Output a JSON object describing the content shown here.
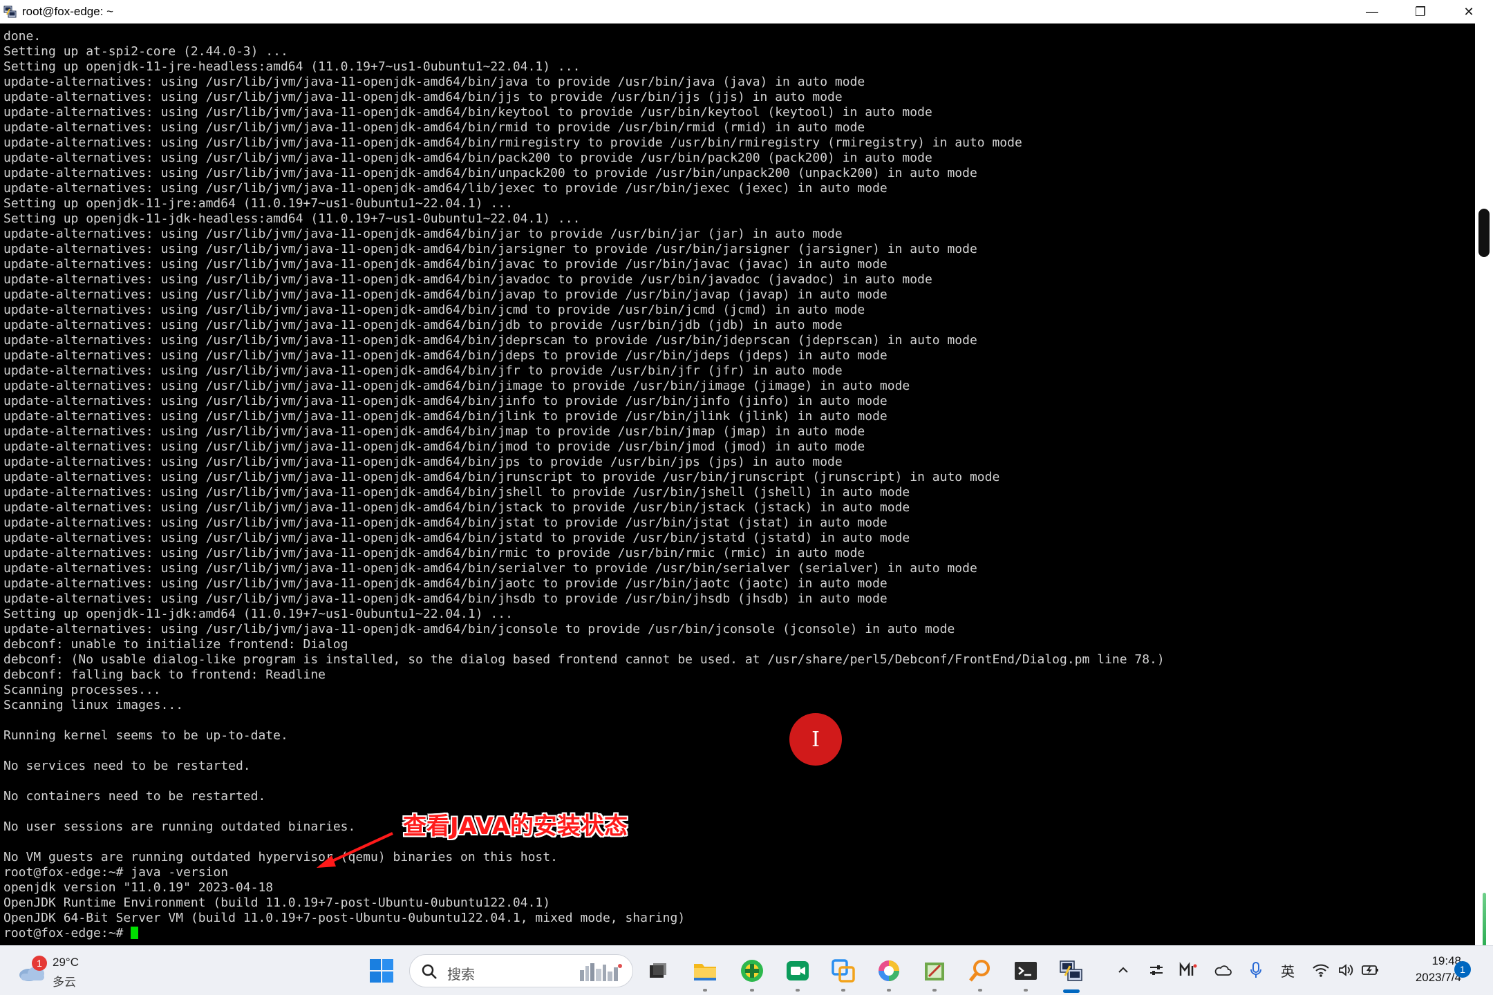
{
  "window": {
    "title": "root@fox-edge: ~",
    "minimize_glyph": "—",
    "restore_glyph": "❐",
    "close_glyph": "✕"
  },
  "terminal": {
    "lines": [
      "done.",
      "Setting up at-spi2-core (2.44.0-3) ...",
      "Setting up openjdk-11-jre-headless:amd64 (11.0.19+7~us1-0ubuntu1~22.04.1) ...",
      "update-alternatives: using /usr/lib/jvm/java-11-openjdk-amd64/bin/java to provide /usr/bin/java (java) in auto mode",
      "update-alternatives: using /usr/lib/jvm/java-11-openjdk-amd64/bin/jjs to provide /usr/bin/jjs (jjs) in auto mode",
      "update-alternatives: using /usr/lib/jvm/java-11-openjdk-amd64/bin/keytool to provide /usr/bin/keytool (keytool) in auto mode",
      "update-alternatives: using /usr/lib/jvm/java-11-openjdk-amd64/bin/rmid to provide /usr/bin/rmid (rmid) in auto mode",
      "update-alternatives: using /usr/lib/jvm/java-11-openjdk-amd64/bin/rmiregistry to provide /usr/bin/rmiregistry (rmiregistry) in auto mode",
      "update-alternatives: using /usr/lib/jvm/java-11-openjdk-amd64/bin/pack200 to provide /usr/bin/pack200 (pack200) in auto mode",
      "update-alternatives: using /usr/lib/jvm/java-11-openjdk-amd64/bin/unpack200 to provide /usr/bin/unpack200 (unpack200) in auto mode",
      "update-alternatives: using /usr/lib/jvm/java-11-openjdk-amd64/lib/jexec to provide /usr/bin/jexec (jexec) in auto mode",
      "Setting up openjdk-11-jre:amd64 (11.0.19+7~us1-0ubuntu1~22.04.1) ...",
      "Setting up openjdk-11-jdk-headless:amd64 (11.0.19+7~us1-0ubuntu1~22.04.1) ...",
      "update-alternatives: using /usr/lib/jvm/java-11-openjdk-amd64/bin/jar to provide /usr/bin/jar (jar) in auto mode",
      "update-alternatives: using /usr/lib/jvm/java-11-openjdk-amd64/bin/jarsigner to provide /usr/bin/jarsigner (jarsigner) in auto mode",
      "update-alternatives: using /usr/lib/jvm/java-11-openjdk-amd64/bin/javac to provide /usr/bin/javac (javac) in auto mode",
      "update-alternatives: using /usr/lib/jvm/java-11-openjdk-amd64/bin/javadoc to provide /usr/bin/javadoc (javadoc) in auto mode",
      "update-alternatives: using /usr/lib/jvm/java-11-openjdk-amd64/bin/javap to provide /usr/bin/javap (javap) in auto mode",
      "update-alternatives: using /usr/lib/jvm/java-11-openjdk-amd64/bin/jcmd to provide /usr/bin/jcmd (jcmd) in auto mode",
      "update-alternatives: using /usr/lib/jvm/java-11-openjdk-amd64/bin/jdb to provide /usr/bin/jdb (jdb) in auto mode",
      "update-alternatives: using /usr/lib/jvm/java-11-openjdk-amd64/bin/jdeprscan to provide /usr/bin/jdeprscan (jdeprscan) in auto mode",
      "update-alternatives: using /usr/lib/jvm/java-11-openjdk-amd64/bin/jdeps to provide /usr/bin/jdeps (jdeps) in auto mode",
      "update-alternatives: using /usr/lib/jvm/java-11-openjdk-amd64/bin/jfr to provide /usr/bin/jfr (jfr) in auto mode",
      "update-alternatives: using /usr/lib/jvm/java-11-openjdk-amd64/bin/jimage to provide /usr/bin/jimage (jimage) in auto mode",
      "update-alternatives: using /usr/lib/jvm/java-11-openjdk-amd64/bin/jinfo to provide /usr/bin/jinfo (jinfo) in auto mode",
      "update-alternatives: using /usr/lib/jvm/java-11-openjdk-amd64/bin/jlink to provide /usr/bin/jlink (jlink) in auto mode",
      "update-alternatives: using /usr/lib/jvm/java-11-openjdk-amd64/bin/jmap to provide /usr/bin/jmap (jmap) in auto mode",
      "update-alternatives: using /usr/lib/jvm/java-11-openjdk-amd64/bin/jmod to provide /usr/bin/jmod (jmod) in auto mode",
      "update-alternatives: using /usr/lib/jvm/java-11-openjdk-amd64/bin/jps to provide /usr/bin/jps (jps) in auto mode",
      "update-alternatives: using /usr/lib/jvm/java-11-openjdk-amd64/bin/jrunscript to provide /usr/bin/jrunscript (jrunscript) in auto mode",
      "update-alternatives: using /usr/lib/jvm/java-11-openjdk-amd64/bin/jshell to provide /usr/bin/jshell (jshell) in auto mode",
      "update-alternatives: using /usr/lib/jvm/java-11-openjdk-amd64/bin/jstack to provide /usr/bin/jstack (jstack) in auto mode",
      "update-alternatives: using /usr/lib/jvm/java-11-openjdk-amd64/bin/jstat to provide /usr/bin/jstat (jstat) in auto mode",
      "update-alternatives: using /usr/lib/jvm/java-11-openjdk-amd64/bin/jstatd to provide /usr/bin/jstatd (jstatd) in auto mode",
      "update-alternatives: using /usr/lib/jvm/java-11-openjdk-amd64/bin/rmic to provide /usr/bin/rmic (rmic) in auto mode",
      "update-alternatives: using /usr/lib/jvm/java-11-openjdk-amd64/bin/serialver to provide /usr/bin/serialver (serialver) in auto mode",
      "update-alternatives: using /usr/lib/jvm/java-11-openjdk-amd64/bin/jaotc to provide /usr/bin/jaotc (jaotc) in auto mode",
      "update-alternatives: using /usr/lib/jvm/java-11-openjdk-amd64/bin/jhsdb to provide /usr/bin/jhsdb (jhsdb) in auto mode",
      "Setting up openjdk-11-jdk:amd64 (11.0.19+7~us1-0ubuntu1~22.04.1) ...",
      "update-alternatives: using /usr/lib/jvm/java-11-openjdk-amd64/bin/jconsole to provide /usr/bin/jconsole (jconsole) in auto mode",
      "debconf: unable to initialize frontend: Dialog",
      "debconf: (No usable dialog-like program is installed, so the dialog based frontend cannot be used. at /usr/share/perl5/Debconf/FrontEnd/Dialog.pm line 78.)",
      "debconf: falling back to frontend: Readline",
      "Scanning processes...",
      "Scanning linux images...",
      "",
      "Running kernel seems to be up-to-date.",
      "",
      "No services need to be restarted.",
      "",
      "No containers need to be restarted.",
      "",
      "No user sessions are running outdated binaries.",
      "",
      "No VM guests are running outdated hypervisor (qemu) binaries on this host.",
      "root@fox-edge:~# java -version",
      "openjdk version \"11.0.19\" 2023-04-18",
      "OpenJDK Runtime Environment (build 11.0.19+7-post-Ubuntu-0ubuntu122.04.1)",
      "OpenJDK 64-Bit Server VM (build 11.0.19+7-post-Ubuntu-0ubuntu122.04.1, mixed mode, sharing)"
    ],
    "prompt": "root@fox-edge:~# ",
    "text_color": "#d2d2d2",
    "cursor_color": "#00e000"
  },
  "annotation": {
    "text": "查看JAVA的安装状态",
    "click_glyph": "I",
    "color": "#ff1a1a"
  },
  "taskbar": {
    "weather": {
      "badge": "1",
      "temp": "29°C",
      "desc": "多云"
    },
    "search_placeholder": "搜索",
    "apps": [
      "start-icon",
      "task-view-icon",
      "file-explorer-icon",
      "green-plus-app-icon",
      "video-meeting-icon",
      "remote-desktop-icon",
      "browser-icon",
      "tools-app-icon",
      "search-tool-icon",
      "terminal-icon",
      "putty-icon"
    ],
    "tray": {
      "ime_label": "英",
      "time": "19:48",
      "date": "2023/7/4",
      "notification_count": "1"
    }
  }
}
